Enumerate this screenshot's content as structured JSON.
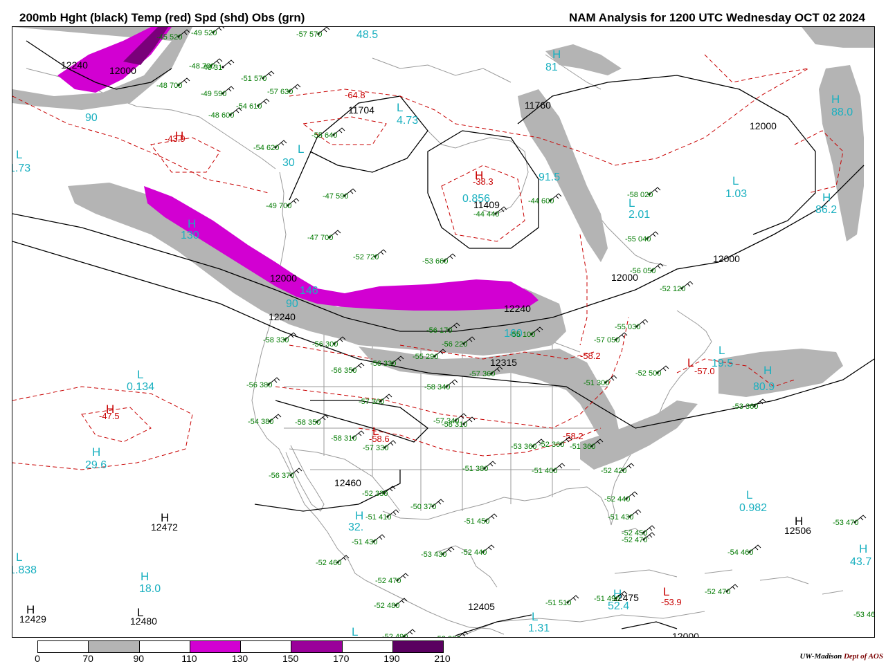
{
  "title_left": "200mb Hght (black) Temp (red) Spd (shd) Obs (grn)",
  "title_right": "NAM Analysis for 1200 UTC Wednesday  OCT 02 2024",
  "credit": {
    "org": "UW-Madison",
    "dept": "Dept of AOS"
  },
  "colors": {
    "height_contour": "#000000",
    "temp_contour": "#c80000",
    "speed_label": "#1ab0c0",
    "obs": "#007a00",
    "geography": "#9a9a9a",
    "shade_70_90": "#b4b4b4",
    "shade_110_130": "#d200d2",
    "shade_150_170": "#9a009a",
    "shade_190_210": "#5a0060"
  },
  "colorbar": {
    "ticks": [
      "0",
      "70",
      "90",
      "110",
      "130",
      "150",
      "170",
      "190",
      "210"
    ],
    "segments": [
      "#ffffff",
      "#b4b4b4",
      "#ffffff",
      "#d200d2",
      "#ffffff",
      "#9a009a",
      "#ffffff",
      "#5a0060"
    ]
  },
  "height_labels": [
    "12240",
    "12000",
    "11704",
    "11760",
    "12000",
    "11409",
    "12000",
    "12000",
    "12000",
    "12240",
    "12240",
    "12315",
    "12460",
    "12472",
    "12429",
    "12480",
    "12405",
    "12475",
    "12506",
    "12000"
  ],
  "temp_labels": [
    "-43.9",
    "-64.8",
    "-38.3",
    "-47.5",
    "-58.6",
    "-58.2",
    "-57.0",
    "-58.2",
    "-53.9"
  ],
  "speed_labels": [
    "48.5",
    "90",
    "4.73",
    "1.73",
    "30",
    "81",
    "91.5",
    "0.856",
    "88.0",
    "1.03",
    "86.2",
    "130",
    "2.01",
    "146",
    "90",
    "160",
    "19.5",
    "80.9",
    "0.134",
    "29.6",
    "0.982",
    "32.",
    "18.0",
    "1.31",
    "52.4",
    "43.7",
    "1.838"
  ],
  "obs_labels": [
    "-45 520",
    "-49 520",
    "-57 570",
    "-48 700",
    "-48 31",
    "-51 570",
    "-48 700",
    "-57 630",
    "-49 590",
    "-54 610",
    "-48 600",
    "-54 620",
    "-55 640",
    "-47 590",
    "-49 700",
    "-47 700",
    "-52 720",
    "-53 660",
    "-44 600",
    "-44 440",
    "-58 020",
    "-55 040",
    "-56 050",
    "-52 120",
    "-55 030",
    "-57 050",
    "-55 100",
    "-56 170",
    "-56 220",
    "-56 300",
    "-58 330",
    "-56 330",
    "-55 290",
    "-56 350",
    "-57 360",
    "-56 380",
    "-54 380",
    "-58 350",
    "-58 310",
    "-57 330",
    "-58 340",
    "-57 360",
    "-57 340",
    "-58 310",
    "-53 360",
    "-52 360",
    "-51 360",
    "-51 400",
    "-52 420",
    "-52 440",
    "-51 430",
    "-52 450",
    "-52 470",
    "-52 470",
    "-54 460",
    "-53 470",
    "-53 460",
    "-53 430",
    "-52 440",
    "-51 450",
    "-51 430",
    "-52 480",
    "-52 470",
    "-52 490",
    "-52 380",
    "-52 460",
    "-51 410",
    "-52 330",
    "-50 370",
    "-51 380",
    "-56 370",
    "-51 490",
    "-51 510",
    "-53 360",
    "-51 300",
    "-52 500"
  ]
}
